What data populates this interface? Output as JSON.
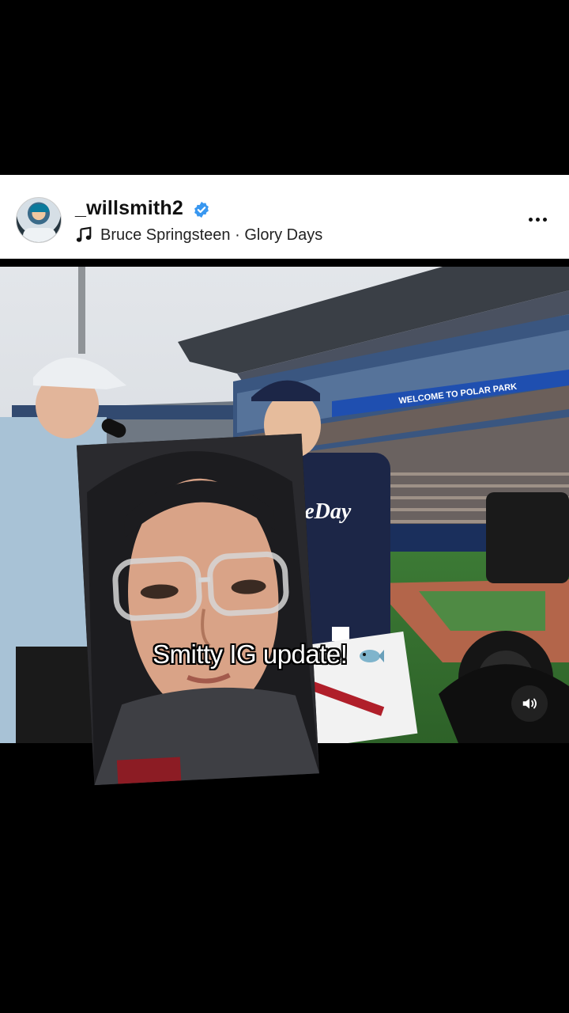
{
  "post": {
    "username": "_willsmith2",
    "verified": true,
    "music": {
      "icon": "music-note-icon",
      "song_label": "Bruce Springsteen · Glory Days"
    },
    "more_icon": "more-options-icon"
  },
  "media": {
    "banner_text": "WELCOME TO POLAR PARK",
    "jersey_text": "WaveDay",
    "caption": "Smitty IG update!",
    "caption_emoji": "fish-emoji",
    "sound_icon": "speaker-icon"
  },
  "colors": {
    "header_bg": "#ffffff",
    "page_bg": "#000000",
    "verified_blue": "#3897f0",
    "stadium_blue": "#1f4a8a",
    "jersey_navy": "#1c2647"
  }
}
